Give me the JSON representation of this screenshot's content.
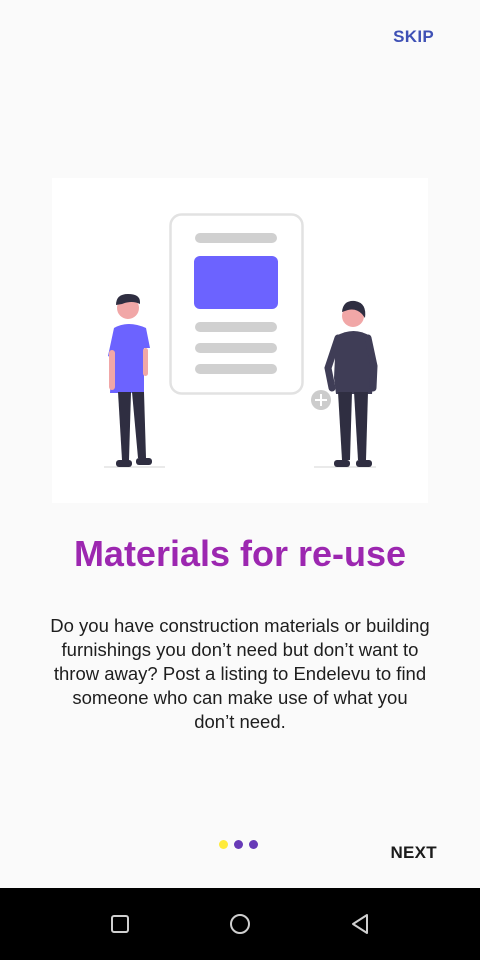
{
  "header": {
    "skip_label": "SKIP"
  },
  "slide": {
    "title": "Materials for re-use",
    "description": "Do you have construction materials or building furnishings you don’t need but don’t want to throw away? Post a listing to Endelevu to find someone who can make use of what you don’t need."
  },
  "pager": {
    "total": 3,
    "current": 1,
    "dot_colors": [
      "#ffeb3b",
      "#673ab7",
      "#673ab7"
    ]
  },
  "footer": {
    "next_label": "NEXT"
  },
  "colors": {
    "accent_purple": "#9c27b0",
    "skip_blue": "#3f51b5",
    "illustration_violet": "#6c63ff"
  },
  "system_nav": {
    "icons": [
      "recents-square-icon",
      "home-circle-icon",
      "back-triangle-icon"
    ]
  }
}
